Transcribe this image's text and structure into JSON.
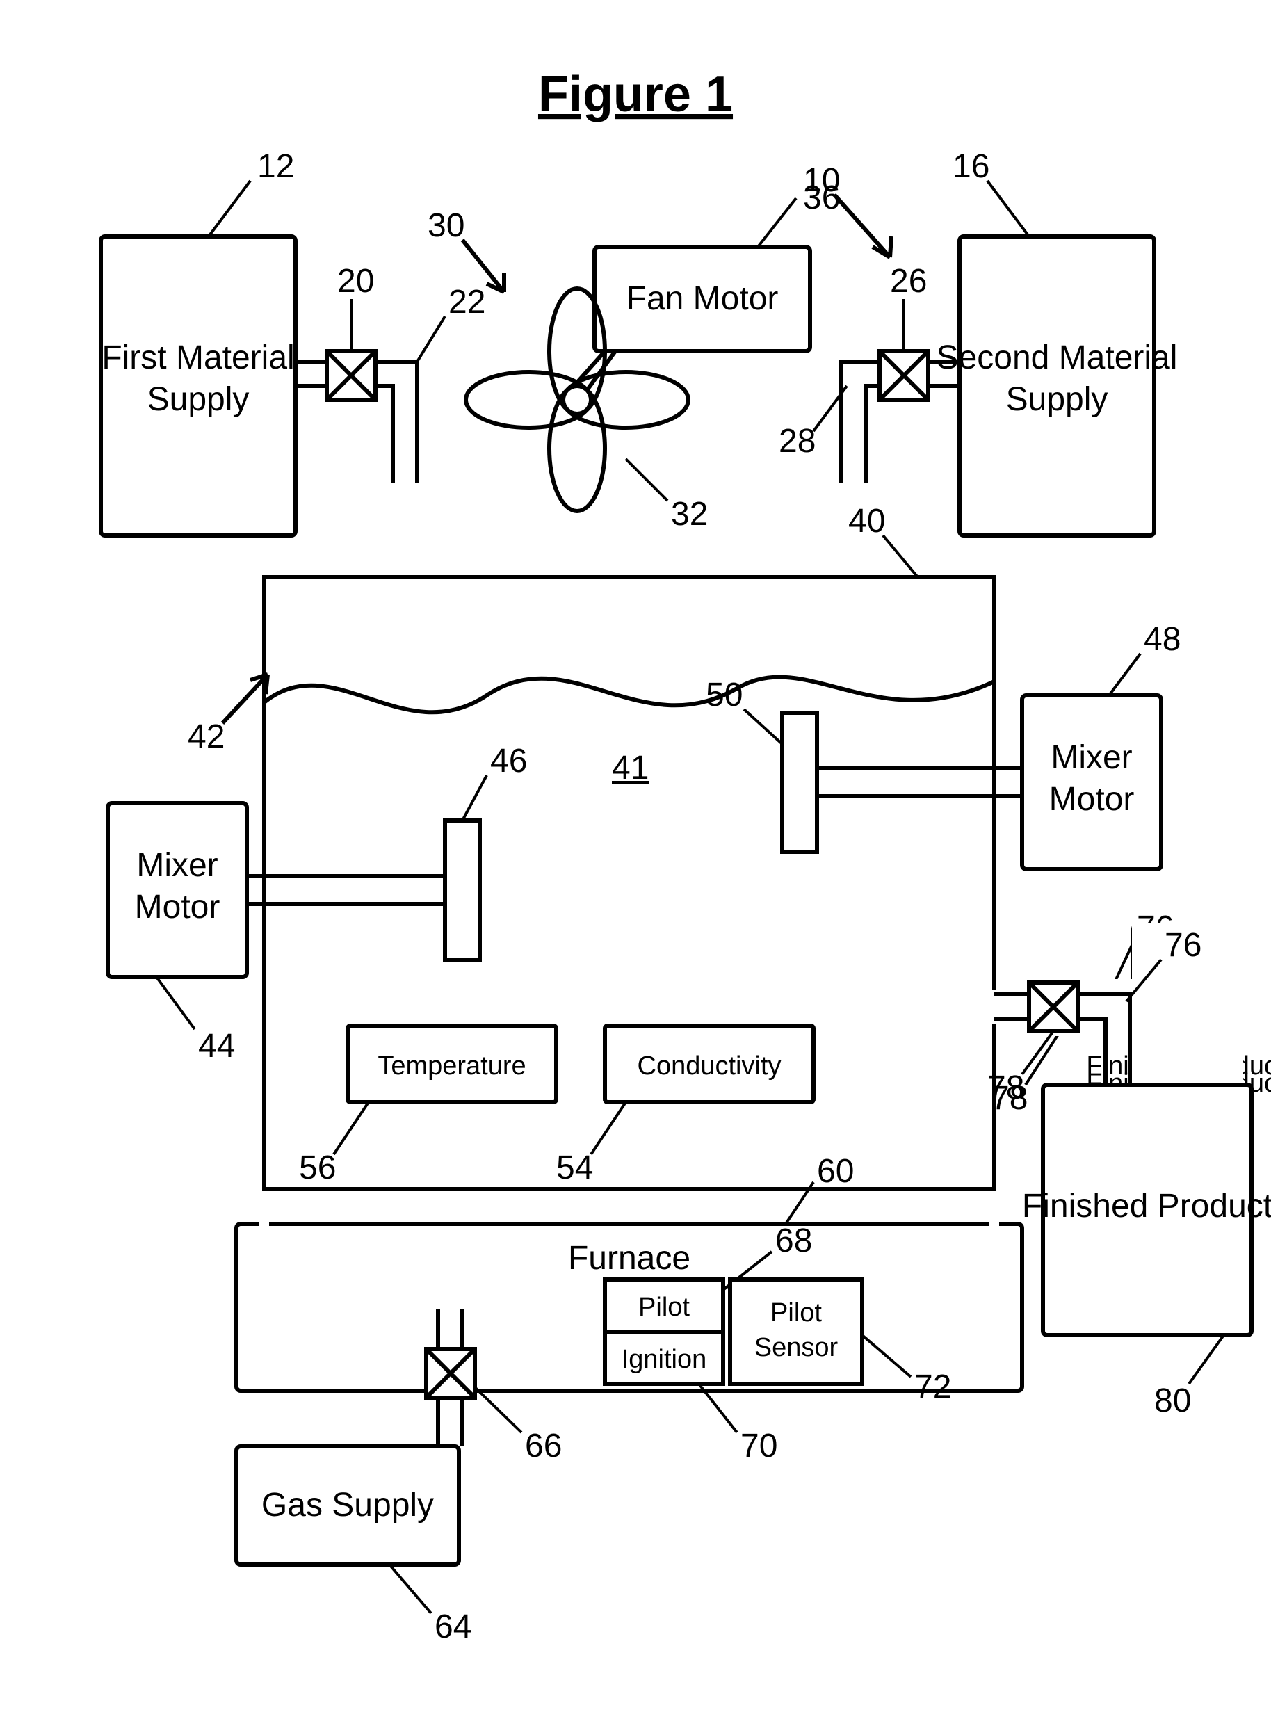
{
  "title": "Figure 1",
  "blocks": {
    "first_supply": {
      "l1": "First Material",
      "l2": "Supply"
    },
    "second_supply": {
      "l1": "Second Material",
      "l2": "Supply"
    },
    "fan_motor": "Fan Motor",
    "mixer_motor_l": {
      "l1": "Mixer",
      "l2": "Motor"
    },
    "mixer_motor_r": {
      "l1": "Mixer",
      "l2": "Motor"
    },
    "temperature": "Temperature",
    "conductivity": "Conductivity",
    "furnace": "Furnace",
    "pilot": "Pilot",
    "ignition": "Ignition",
    "pilot_sensor": {
      "l1": "Pilot",
      "l2": "Sensor"
    },
    "gas_supply": "Gas Supply",
    "finished_product": "Finished Product"
  },
  "refs": {
    "n10": "10",
    "n12": "12",
    "n16": "16",
    "n20": "20",
    "n22": "22",
    "n26": "26",
    "n28": "28",
    "n30": "30",
    "n32": "32",
    "n36": "36",
    "n40": "40",
    "n41": "41",
    "n42": "42",
    "n44": "44",
    "n46": "46",
    "n48": "48",
    "n50": "50",
    "n54": "54",
    "n56": "56",
    "n60": "60",
    "n64": "64",
    "n66": "66",
    "n68": "68",
    "n70": "70",
    "n72": "72",
    "n76": "76",
    "n78": "78",
    "n80": "80"
  }
}
